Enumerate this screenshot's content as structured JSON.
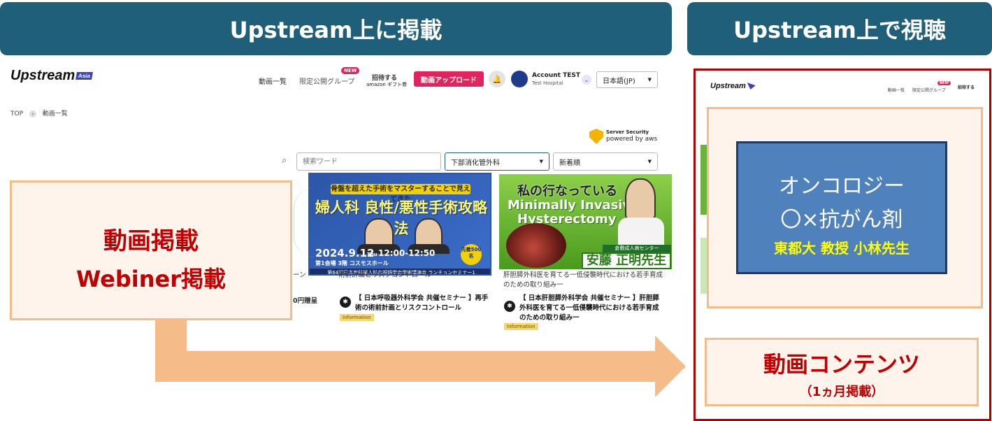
{
  "banners": {
    "left": "Upstream上に掲載",
    "right": "Upstream上で視聴"
  },
  "site": {
    "logo": "Upstream",
    "logo_tag": "Asia",
    "nav": {
      "videos": "動画一覧",
      "private_group": "限定公開グループ",
      "new_badge": "NEW",
      "invite_l1": "招待する",
      "invite_l2": "amazon ギフト券",
      "upload": "動画アップロード"
    },
    "account": {
      "name": "Account TEST",
      "hospital": "Test Hospital"
    },
    "language": "日本語(JP)",
    "breadcrumb": {
      "top": "TOP",
      "current": "動画一覧"
    },
    "security": {
      "l1": "Server Security",
      "l2": "powered by aws"
    },
    "filters": {
      "search_placeholder": "検索ワード",
      "department": "下部消化管外科",
      "sort": "新着順"
    }
  },
  "thumb1": {
    "ribbon": "骨盤を超えた手術をマスターすることで見えてきた",
    "title": "婦人科 良性/悪性手術攻略法",
    "date": "2024.9.12",
    "day": "Thu",
    "time": "12:00-12:50",
    "venue": "第1会場 3階 コスモスホール",
    "seats": "先着500名",
    "footer": "第64回日本産科婦人科内視鏡学会学術講演会 ランチョンセミナー1"
  },
  "thumb2": {
    "title1": "私の行なっている",
    "title2": "Minimally Invasive",
    "title3": "Hysterectomy",
    "hospital": "倉敷成人病センター",
    "name": "安藤 正明先生"
  },
  "cards": [
    {
      "partial_text": "術前計画とリスクコントロール",
      "title": "【 日本呼吸器外科学会 共催セミナー 】再手術の術前計画とリスクコントロール",
      "tag": "Information"
    },
    {
      "partial_text": "肝胆膵外科医を育てる一低侵襲時代における若手育成のための取り組み一",
      "title": "【 日本肝胆膵外科学会 共催セミナー 】肝胆膵外科医を育てる一低侵襲時代における若手育成のための取り組み一",
      "tag": "Information"
    }
  ],
  "left_overflow": {
    "l1": "ーン",
    "l2": "0円贈呈"
  },
  "posting_box": {
    "l1": "動画掲載",
    "l2": "Webiner掲載"
  },
  "right_panel": {
    "logo": "Upstream",
    "nav_videos": "動画一覧",
    "nav_private": "限定公開グループ",
    "new_badge": "NEW",
    "invite": "招待する",
    "onco": {
      "l1": "オンコロジー",
      "l2": "〇×抗がん剤",
      "l3": "東都大 教授 小林先生"
    },
    "content": {
      "l1": "動画コンテンツ",
      "l2": "（1ヵ月掲載）"
    }
  },
  "colors": {
    "banner": "#1f5f7a",
    "accent_pink": "#e0245e",
    "peach": "#f5bc8a",
    "red_text": "#c00000",
    "onco_blue": "#4f81bd"
  }
}
